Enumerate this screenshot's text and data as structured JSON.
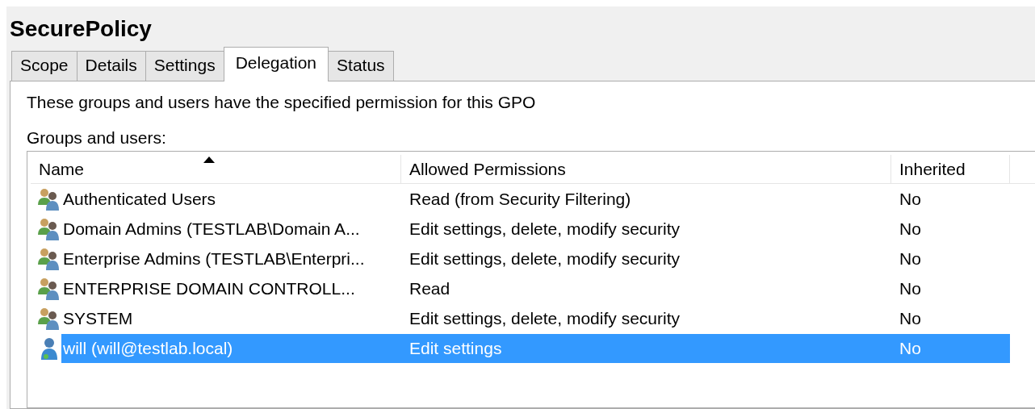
{
  "window": {
    "title": "SecurePolicy"
  },
  "tabs": [
    {
      "label": "Scope",
      "selected": false
    },
    {
      "label": "Details",
      "selected": false
    },
    {
      "label": "Settings",
      "selected": false
    },
    {
      "label": "Delegation",
      "selected": true
    },
    {
      "label": "Status",
      "selected": false
    }
  ],
  "description": "These groups and users have the specified permission for this GPO",
  "list_label": "Groups and users:",
  "table": {
    "columns": [
      {
        "label": "Name",
        "sort_ascending": true
      },
      {
        "label": "Allowed Permissions"
      },
      {
        "label": "Inherited"
      }
    ],
    "rows": [
      {
        "kind": "group",
        "name": "Authenticated Users",
        "permissions": "Read (from Security Filtering)",
        "inherited": "No",
        "selected": false
      },
      {
        "kind": "group",
        "name": "Domain Admins (TESTLAB\\Domain A...",
        "permissions": "Edit settings, delete, modify security",
        "inherited": "No",
        "selected": false
      },
      {
        "kind": "group",
        "name": "Enterprise Admins (TESTLAB\\Enterpri...",
        "permissions": "Edit settings, delete, modify security",
        "inherited": "No",
        "selected": false
      },
      {
        "kind": "group",
        "name": "ENTERPRISE DOMAIN CONTROLL...",
        "permissions": "Read",
        "inherited": "No",
        "selected": false
      },
      {
        "kind": "group",
        "name": "SYSTEM",
        "permissions": "Edit settings, delete, modify security",
        "inherited": "No",
        "selected": false
      },
      {
        "kind": "user",
        "name": "will (will@testlab.local)",
        "permissions": "Edit settings",
        "inherited": "No",
        "selected": true
      }
    ]
  }
}
